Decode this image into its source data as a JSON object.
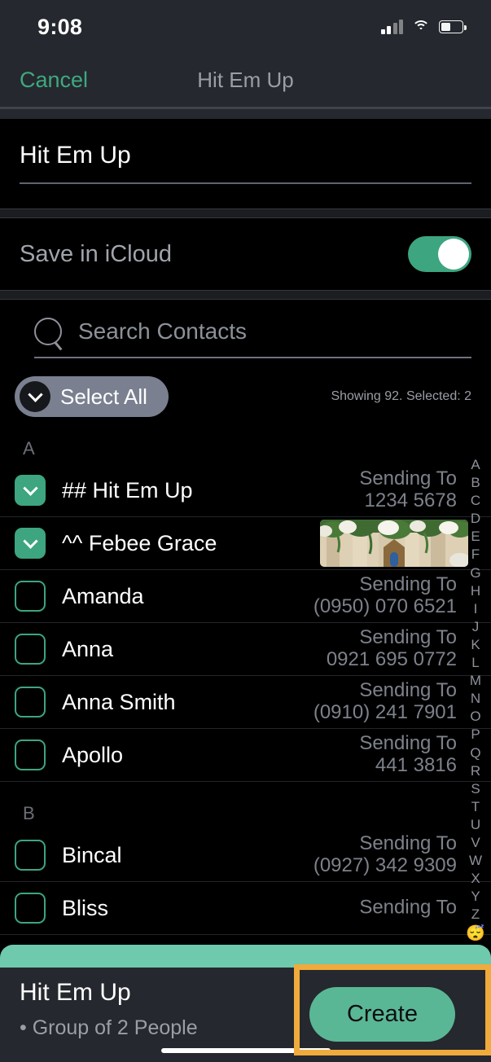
{
  "status_bar": {
    "time": "9:08",
    "cellular_icon": "cellular-bars-icon",
    "wifi_icon": "wifi-icon",
    "battery_icon": "battery-icon"
  },
  "nav": {
    "cancel_label": "Cancel",
    "title": "Hit Em Up"
  },
  "name_field": {
    "value": "Hit Em Up"
  },
  "icloud": {
    "label": "Save in iCloud",
    "toggle_state": "on"
  },
  "search": {
    "placeholder": "Search Contacts",
    "icon": "search-icon"
  },
  "select_all": {
    "label": "Select All",
    "icon": "chevron-down-icon",
    "showing_text": "Showing 92. Selected: 2"
  },
  "sections": [
    {
      "letter": "A",
      "contacts": [
        {
          "name": "## Hit Em Up",
          "checked": true,
          "sending_label": "Sending To",
          "number": "1234 5678",
          "has_thumbnail": false
        },
        {
          "name": "^^ Febee  Grace",
          "checked": true,
          "sending_label": "",
          "number": "",
          "has_thumbnail": true
        },
        {
          "name": "Amanda",
          "checked": false,
          "sending_label": "Sending To",
          "number": "(0950) 070 6521",
          "has_thumbnail": false
        },
        {
          "name": "Anna",
          "checked": false,
          "sending_label": "Sending To",
          "number": "0921 695 0772",
          "has_thumbnail": false
        },
        {
          "name": "Anna  Smith",
          "checked": false,
          "sending_label": "Sending To",
          "number": "(0910) 241 7901",
          "has_thumbnail": false
        },
        {
          "name": "Apollo",
          "checked": false,
          "sending_label": "Sending To",
          "number": "441 3816",
          "has_thumbnail": false
        }
      ]
    },
    {
      "letter": "B",
      "contacts": [
        {
          "name": "Bincal",
          "checked": false,
          "sending_label": "Sending To",
          "number": "(0927) 342 9309",
          "has_thumbnail": false
        },
        {
          "name": "Bliss",
          "checked": false,
          "sending_label": "Sending To",
          "number": "",
          "has_thumbnail": false
        }
      ]
    }
  ],
  "az_index": [
    "A",
    "B",
    "C",
    "D",
    "E",
    "F",
    "G",
    "H",
    "I",
    "J",
    "K",
    "L",
    "M",
    "N",
    "O",
    "P",
    "Q",
    "R",
    "S",
    "T",
    "U",
    "V",
    "W",
    "X",
    "Y",
    "Z"
  ],
  "az_index_emoji": "😴",
  "bottom_bar": {
    "title": "Hit Em Up",
    "subtitle": "• Group of 2 People",
    "create_label": "Create"
  },
  "colors": {
    "accent_green": "#3da57f",
    "cancel_green": "#3fa87f",
    "teal_strip": "#6fc9ad",
    "create_button": "#5ab795",
    "highlight": "#efab3c",
    "bar_bg": "#25282e"
  }
}
